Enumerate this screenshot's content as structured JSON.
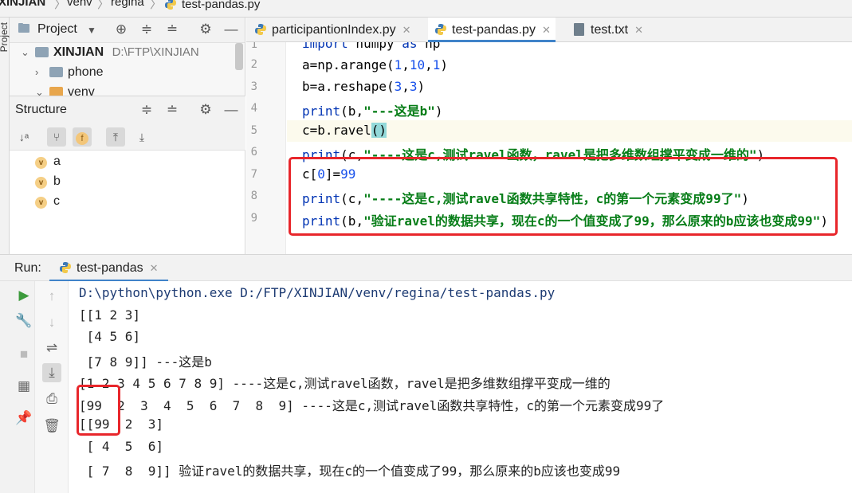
{
  "breadcrumb": {
    "items": [
      "XINJIAN",
      "venv",
      "regina",
      "test-pandas.py"
    ]
  },
  "left_strip": {
    "label": "Project"
  },
  "project_panel": {
    "title": "Project",
    "tree": [
      {
        "name": "XINJIAN",
        "path": "D:\\FTP\\XINJIAN",
        "expanded": true
      },
      {
        "name": "phone",
        "expanded": false
      },
      {
        "name": "venv",
        "expanded": true
      }
    ]
  },
  "structure_panel": {
    "title": "Structure",
    "items": [
      "a",
      "b",
      "c"
    ]
  },
  "editor": {
    "tabs": [
      {
        "label": "participantionIndex.py",
        "active": false
      },
      {
        "label": "test-pandas.py",
        "active": true
      },
      {
        "label": "test.txt",
        "active": false
      }
    ],
    "line_numbers": [
      "1",
      "2",
      "3",
      "4",
      "5",
      "6",
      "7",
      "8",
      "9"
    ],
    "lines": {
      "l1": [
        "import",
        " numpy ",
        "as",
        " np"
      ],
      "l2": [
        "a=np.arange(",
        "1",
        ",",
        "10",
        ",",
        "1",
        ")"
      ],
      "l3": [
        "b=a.reshape(",
        "3",
        ",",
        "3",
        ")"
      ],
      "l4": [
        "print",
        "(b,",
        "\"---这是b\"",
        ")"
      ],
      "l5": [
        "c=b.ravel",
        "(",
        ")"
      ],
      "l6": [
        "print",
        "(c,",
        "\"----这是c,测试ravel函数，ravel是把多维数组撑平变成一维的\"",
        ")"
      ],
      "l7": [
        "c[",
        "0",
        "]=",
        "99"
      ],
      "l8": [
        "print",
        "(c,",
        "\"----这是c,测试ravel函数共享特性，c的第一个元素变成99了\"",
        ")"
      ],
      "l9": [
        "print",
        "(b,",
        "\"验证ravel的数据共享，现在c的一个值变成了99，那么原来的b应该也变成99\"",
        ")"
      ]
    }
  },
  "run_panel": {
    "label": "Run:",
    "tab_label": "test-pandas",
    "output": [
      "D:\\python\\python.exe D:/FTP/XINJIAN/venv/regina/test-pandas.py",
      "[[1 2 3]",
      " [4 5 6]",
      " [7 8 9]] ---这是b",
      "[1 2 3 4 5 6 7 8 9] ----这是c,测试ravel函数，ravel是把多维数组撑平变成一维的",
      "[99  2  3  4  5  6  7  8  9] ----这是c,测试ravel函数共享特性，c的第一个元素变成99了",
      "[[99  2  3]",
      " [ 4  5  6]",
      " [ 7  8  9]] 验证ravel的数据共享，现在c的一个值变成了99，那么原来的b应该也变成99"
    ]
  },
  "colors": {
    "annotation_red": "#e8262b",
    "accent_blue": "#4083c9",
    "string_green": "#067d17",
    "keyword_blue": "#0033b3",
    "number_blue": "#1750eb"
  }
}
